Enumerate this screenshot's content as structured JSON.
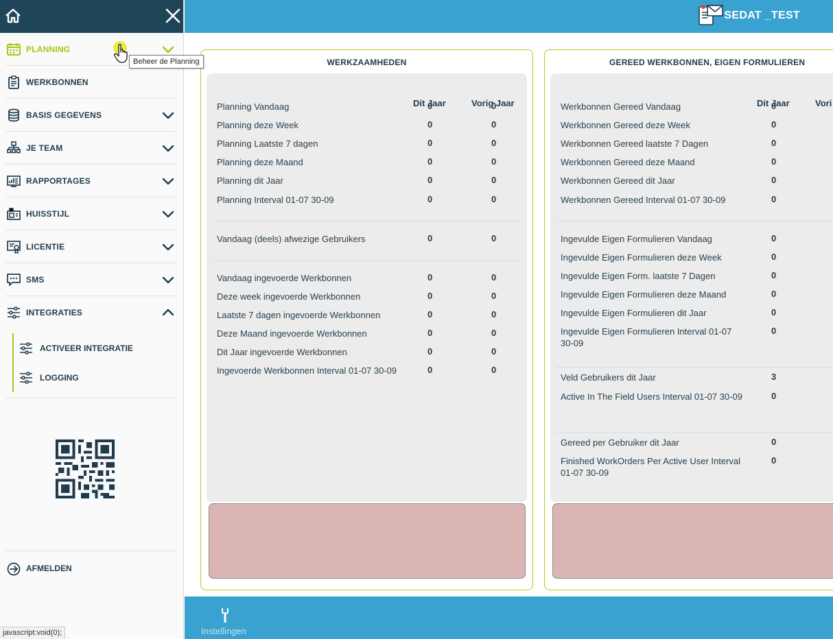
{
  "sidebar": {
    "menu": [
      {
        "label": "PLANNING",
        "icon": "calendar-icon",
        "active": true,
        "expanded": false
      },
      {
        "label": "WERKBONNEN",
        "icon": "clipboard-icon"
      },
      {
        "label": "BASIS GEGEVENS",
        "icon": "database-icon"
      },
      {
        "label": "JE TEAM",
        "icon": "team-tree-icon"
      },
      {
        "label": "RAPPORTAGES",
        "icon": "report-icon"
      },
      {
        "label": "HUISSTIJL",
        "icon": "branding-icon"
      },
      {
        "label": "LICENTIE",
        "icon": "license-icon"
      },
      {
        "label": "SMS",
        "icon": "sms-icon"
      },
      {
        "label": "INTEGRATIES",
        "icon": "sliders-icon",
        "expanded": true
      }
    ],
    "submenu": [
      {
        "label": "ACTIVEER INTEGRATIE",
        "icon": "sliders-icon"
      },
      {
        "label": "LOGGING",
        "icon": "sliders-icon"
      }
    ],
    "logout_label": "AFMELDEN",
    "status_url": "javascript:void(0);",
    "tooltip": "Beheer de Planning",
    "accent_color": "#a6c718",
    "dark_color": "#1f4559"
  },
  "topbar": {
    "user": "SEDAT _TEST",
    "color": "#3aa2d0"
  },
  "werkzaamheden": {
    "title": "WERKZAAMHEDEN",
    "col_this_year": "Dit Jaar",
    "col_last_year": "Vorig Jaar",
    "rows": [
      {
        "label": "Planning Vandaag",
        "this_year": "0",
        "last_year": "0"
      },
      {
        "label": "Planning deze Week",
        "this_year": "0",
        "last_year": "0"
      },
      {
        "label": "Planning Laatste 7 dagen",
        "this_year": "0",
        "last_year": "0"
      },
      {
        "label": "Planning deze Maand",
        "this_year": "0",
        "last_year": "0"
      },
      {
        "label": "Planning dit Jaar",
        "this_year": "0",
        "last_year": "0"
      },
      {
        "label": "Planning Interval 01-07 30-09",
        "this_year": "0",
        "last_year": "0"
      },
      {
        "label": "Vandaag (deels) afwezige Gebruikers",
        "this_year": "0",
        "last_year": "0"
      },
      {
        "label": "Vandaag ingevoerde Werkbonnen",
        "this_year": "0",
        "last_year": "0"
      },
      {
        "label": "Deze week ingevoerde Werkbonnen",
        "this_year": "0",
        "last_year": "0"
      },
      {
        "label": "Laatste 7 dagen ingevoerde Werkbonnen",
        "this_year": "0",
        "last_year": "0"
      },
      {
        "label": "Deze Maand ingevoerde Werkbonnen",
        "this_year": "0",
        "last_year": "0"
      },
      {
        "label": "Dit Jaar ingevoerde Werkbonnen",
        "this_year": "0",
        "last_year": "0"
      },
      {
        "label": "Ingevoerde Werkbonnen Interval 01-07 30-09",
        "this_year": "0",
        "last_year": "0"
      }
    ]
  },
  "gereed": {
    "title": "GEREED WERKBONNEN, EIGEN FORMULIEREN",
    "col_this_year": "Dit Jaar",
    "col_last_year": "Vori",
    "rows": [
      {
        "label": "Werkbonnen Gereed Vandaag",
        "this_year": "0"
      },
      {
        "label": "Werkbonnen Gereed deze Week",
        "this_year": "0"
      },
      {
        "label": "Werkbonnen Gereed laatste 7 Dagen",
        "this_year": "0"
      },
      {
        "label": "Werkbonnen Gereed deze Maand",
        "this_year": "0"
      },
      {
        "label": "Werkbonnen Gereed dit Jaar",
        "this_year": "0"
      },
      {
        "label": "Werkbonnen Gereed Interval 01-07 30-09",
        "this_year": "0"
      },
      {
        "label": "Ingevulde Eigen Formulieren Vandaag",
        "this_year": "0"
      },
      {
        "label": "Ingevulde Eigen Formulieren deze Week",
        "this_year": "0"
      },
      {
        "label": "Ingevulde Eigen Form. laatste 7 Dagen",
        "this_year": "0"
      },
      {
        "label": "Ingevulde Eigen Formulieren deze Maand",
        "this_year": "0"
      },
      {
        "label": "Ingevulde Eigen Formulieren dit Jaar",
        "this_year": "0"
      },
      {
        "label": "Ingevulde Eigen Formulieren Interval 01-07 30-09",
        "this_year": "0"
      },
      {
        "label": "Veld Gebruikers dit Jaar",
        "this_year": "3"
      },
      {
        "label": "Active In The Field Users Interval 01-07 30-09",
        "this_year": "0"
      },
      {
        "label": "Gereed per Gebruiker dit Jaar",
        "this_year": "0"
      },
      {
        "label": "Finished WorkOrders Per Active User Interval 01-07 30-09",
        "this_year": "0"
      }
    ]
  },
  "bottombar": {
    "settings_label": "Instellingen",
    "settings_icon": "wrench-icon"
  }
}
